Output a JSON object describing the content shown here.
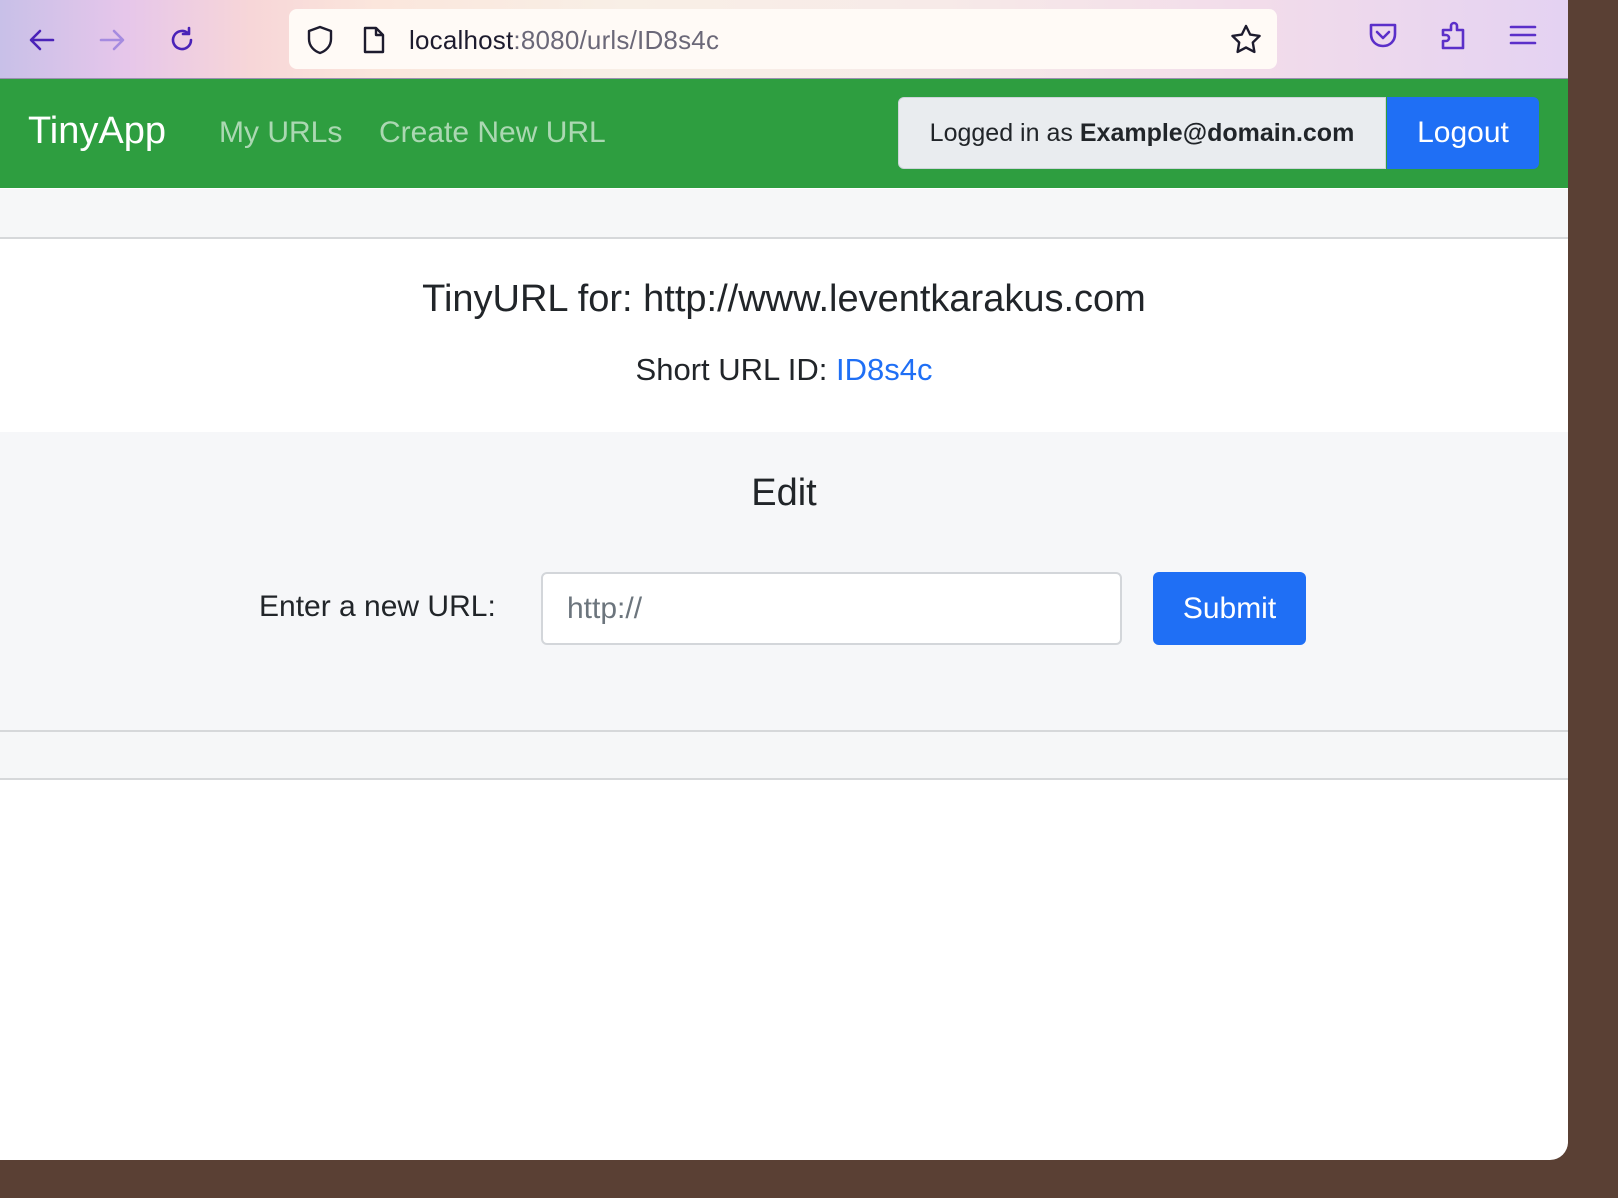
{
  "browser": {
    "url_host": "localhost",
    "url_rest": ":8080/urls/ID8s4c",
    "icons": {
      "back": "arrow-left-icon",
      "forward": "arrow-right-icon",
      "reload": "reload-icon",
      "shield": "shield-icon",
      "page": "page-icon",
      "bookmark": "star-icon",
      "pocket": "pocket-icon",
      "extensions": "puzzle-icon",
      "menu": "hamburger-menu-icon"
    },
    "accent_color": "#5b2fc9"
  },
  "navbar": {
    "brand": "TinyApp",
    "links": [
      "My URLs",
      "Create New URL"
    ],
    "logged_in_prefix": "Logged in as",
    "logged_in_user": "Example@domain.com",
    "logout_label": "Logout",
    "color": "#2e9e40"
  },
  "main": {
    "title": "TinyURL for: http://www.leventkarakus.com",
    "short_id_label": "Short URL ID:",
    "short_id_value": "ID8s4c",
    "link_color": "#1f6ff5"
  },
  "edit": {
    "heading": "Edit",
    "label": "Enter a new URL:",
    "input_placeholder": "http://",
    "input_value": "",
    "submit_label": "Submit"
  }
}
